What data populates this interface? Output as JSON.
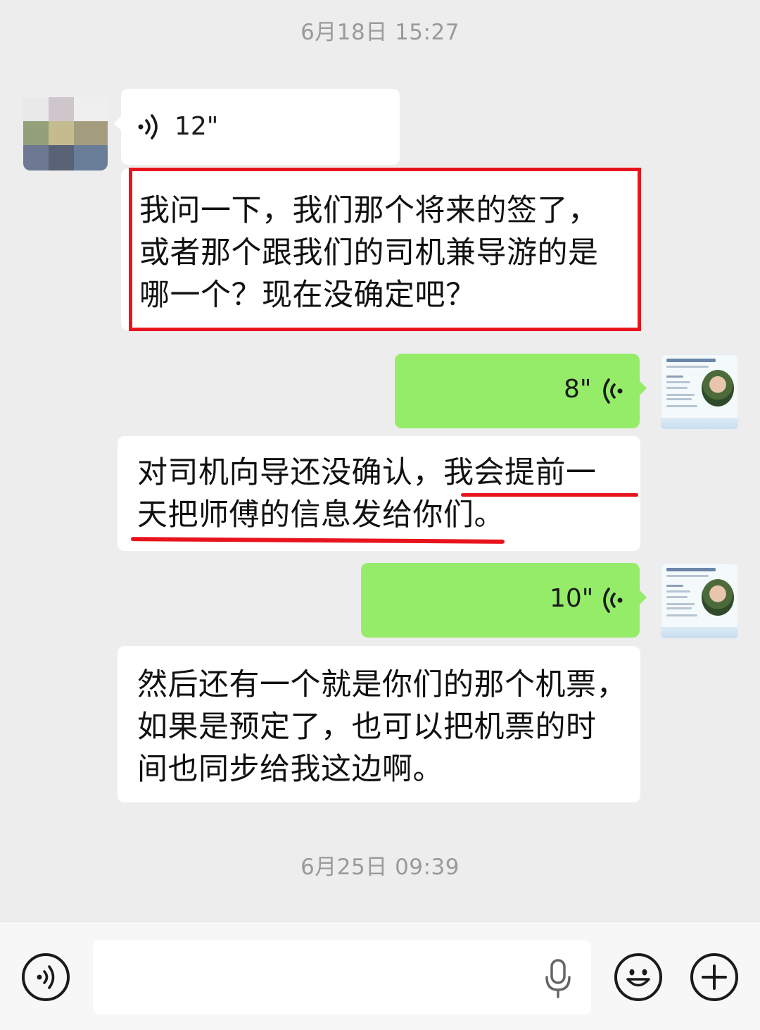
{
  "timestamps": {
    "first": "6月18日 15:27",
    "second": "6月25日 09:39"
  },
  "messages": [
    {
      "type": "voice",
      "direction": "incoming",
      "duration": "12\""
    },
    {
      "type": "text",
      "direction": "incoming",
      "highlighted": "red-box",
      "lines": [
        "我问一下，我们那个将来的签了，",
        "或者那个跟我们的司机兼导游的是",
        "哪一个？现在没确定吧？"
      ]
    },
    {
      "type": "voice",
      "direction": "outgoing",
      "duration": "8\""
    },
    {
      "type": "text",
      "direction": "incoming",
      "highlighted": "red-underline",
      "lines": [
        "对司机向导还没确认，我会提前一",
        "天把师傅的信息发给你们。"
      ]
    },
    {
      "type": "voice",
      "direction": "outgoing",
      "duration": "10\""
    },
    {
      "type": "text",
      "direction": "incoming",
      "lines": [
        "然后还有一个就是你们的那个机票，",
        "如果是预定了，也可以把机票的时",
        "间也同步给我这边啊。"
      ]
    }
  ],
  "input_bar": {
    "placeholder": "",
    "icons": [
      "voice-toggle-icon",
      "microphone-icon",
      "emoji-icon",
      "plus-icon"
    ]
  },
  "colors": {
    "background": "#ededed",
    "incoming_bubble": "#ffffff",
    "outgoing_bubble": "#95ec69",
    "annotation_red": "#e8141d",
    "timestamp_text": "#9a9a9a"
  }
}
